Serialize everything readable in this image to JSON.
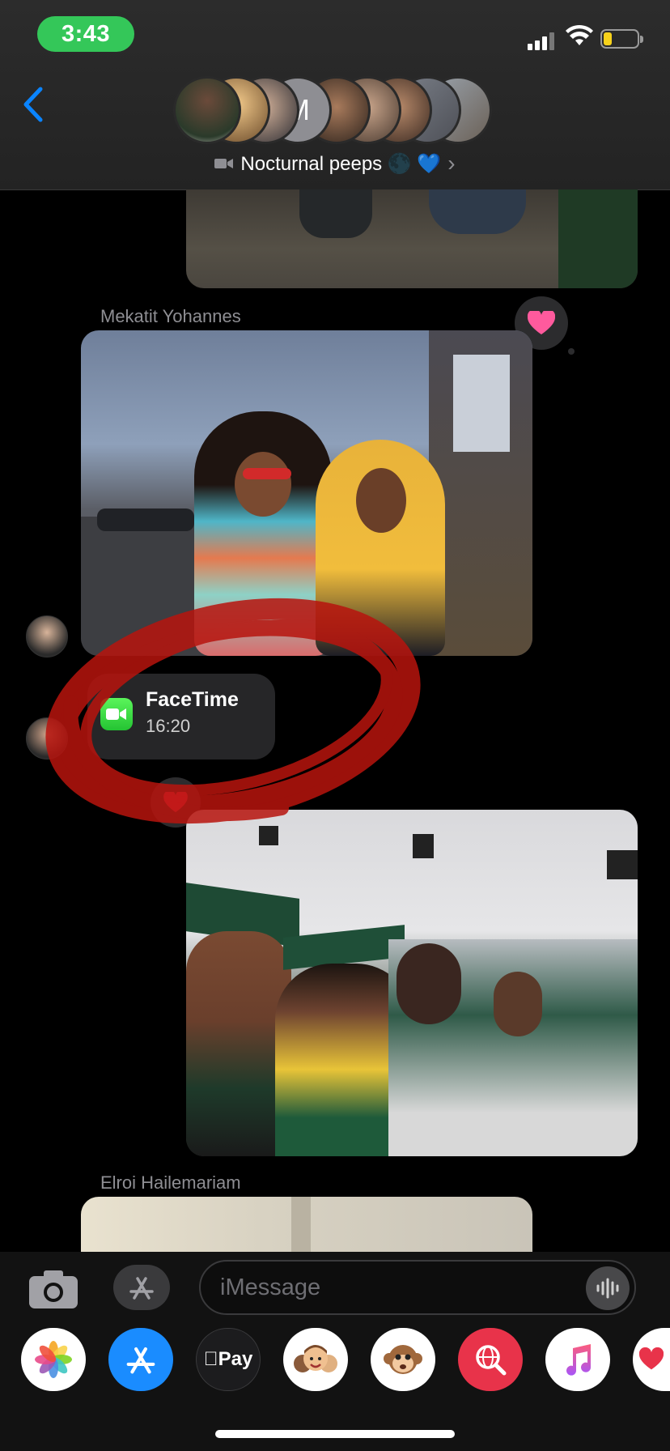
{
  "status": {
    "time": "3:43"
  },
  "header": {
    "avatar_letter": "M",
    "group_name": "Nocturnal peeps 🌑 💙",
    "chevron": "›"
  },
  "messages": [
    {
      "sender": "Mekatit Yohannes"
    },
    {
      "sender": "Elroi Hailemariam"
    }
  ],
  "facetime": {
    "title": "FaceTime",
    "duration": "16:20"
  },
  "composer": {
    "placeholder": "iMessage"
  },
  "drawer": {
    "applepay_label": "Pay"
  },
  "colors": {
    "accent_blue": "#0a84ff",
    "time_pill": "#34c759",
    "tapback_pink": "#ff5a9d",
    "annotation_red": "#b8140e"
  }
}
